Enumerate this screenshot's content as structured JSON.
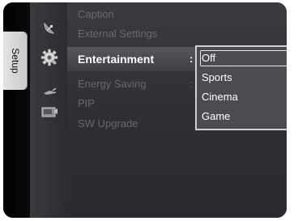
{
  "tab": {
    "label": "Setup"
  },
  "menu": {
    "items": [
      {
        "label": "Caption"
      },
      {
        "label": "External Settings"
      },
      {
        "label": "Entertainment",
        "value_prefix": ":"
      },
      {
        "label": "Energy Saving",
        "value_prefix": ":"
      },
      {
        "label": "PIP"
      },
      {
        "label": "SW Upgrade"
      }
    ]
  },
  "dropdown": {
    "options": [
      "Off",
      "Sports",
      "Cinema",
      "Game"
    ],
    "selected": "Off"
  },
  "icons": [
    "satellite-dish-icon",
    "gear-icon",
    "plug-icon",
    "input-source-icon"
  ],
  "colors": {
    "active_text": "#ffffff",
    "inactive_text": "#6a6a6a",
    "panel": "#3a3b3e"
  }
}
